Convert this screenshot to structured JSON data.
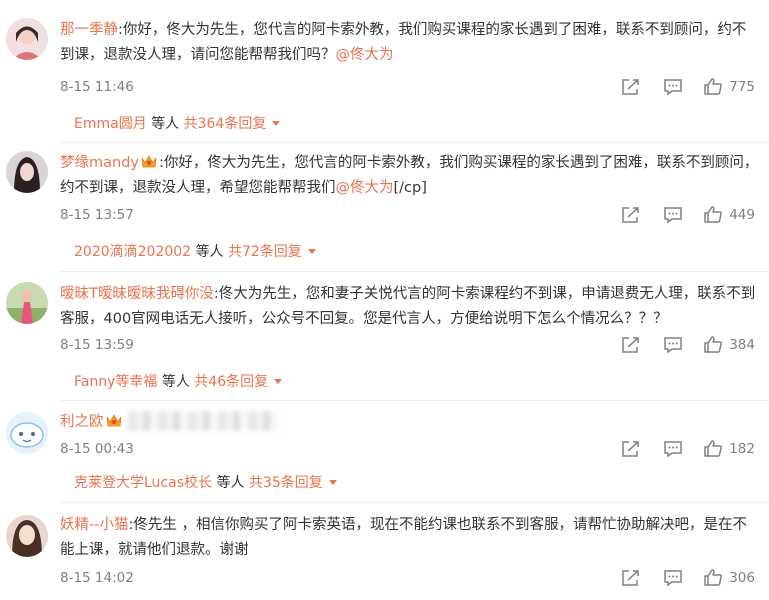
{
  "colors": {
    "accent": "#eb7350",
    "meta": "#808080",
    "text": "#333333"
  },
  "icons": {
    "share": "share-icon",
    "comment": "comment-icon",
    "like": "thumbs-up-icon",
    "vip": "vip-crown-icon"
  },
  "comments": [
    {
      "user": "那一季静",
      "text": ":你好，佟大为先生，您代言的阿卡索外教，我们购买课程的家长遇到了困难，联系不到顾问，约不到课，退款没人理，请问您能帮帮我们吗？",
      "mention": "@佟大为",
      "trailing": "",
      "time": "8-15 11:46",
      "likes": "775",
      "replies": {
        "user": "Emma圆月",
        "mid": " 等人 ",
        "total": "共364条回复"
      }
    },
    {
      "user": "梦缘mandy",
      "text": ":你好，佟大为先生，您代言的阿卡索外教，我们购买课程的家长遇到了困难，联系不到顾问，约不到课，退款没人理，希望您能帮帮我们",
      "mention": "@佟大为",
      "trailing": "[/cp]",
      "time": "8-15 13:57",
      "likes": "449",
      "replies": {
        "user": "2020滴滴202002",
        "mid": " 等人 ",
        "total": "共72条回复"
      }
    },
    {
      "user": "暧昧T暧昧暧昧我碍你没",
      "text": ":佟大为先生，您和妻子关悦代言的阿卡索课程约不到课，申请退费无人理，联系不到客服，400官网电话无人接听，公众号不回复。您是代言人，方便给说明下怎么个情况么？？？",
      "mention": "",
      "trailing": "",
      "time": "8-15 13:59",
      "likes": "384",
      "replies": {
        "user": "Fanny等幸福",
        "mid": " 等人 ",
        "total": "共46条回复"
      }
    },
    {
      "user": "利之欧",
      "text": "",
      "mention": "",
      "trailing": "",
      "time": "8-15 00:43",
      "likes": "182",
      "replies": {
        "user": "克莱登大学Lucas校长",
        "mid": " 等人 ",
        "total": "共35条回复"
      }
    },
    {
      "user": "妖精--小猫",
      "text": ":佟先生 ，相信你购买了阿卡索英语，现在不能约课也联系不到客服，请帮忙协助解决吧，是在不能上课，就请他们退款。谢谢",
      "mention": "",
      "trailing": "",
      "time": "8-15 14:02",
      "likes": "306"
    }
  ]
}
